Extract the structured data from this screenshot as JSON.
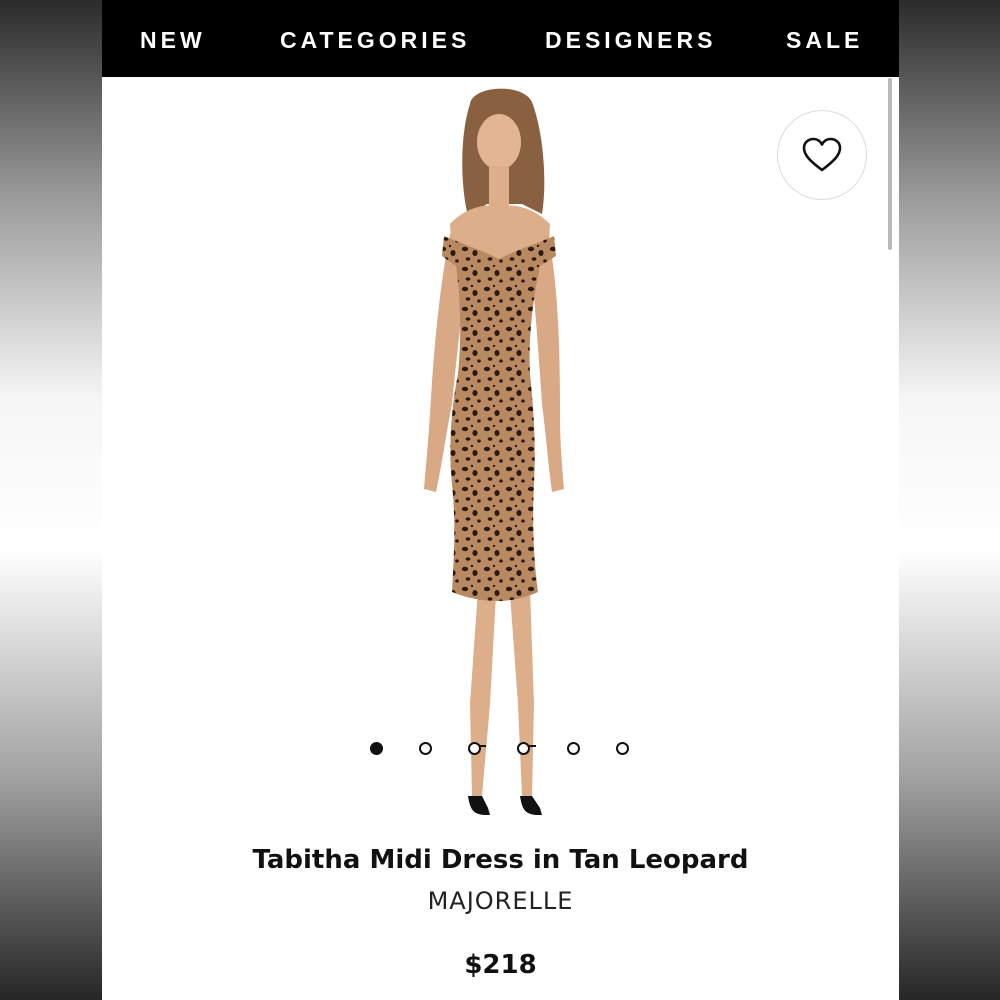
{
  "nav": {
    "items": [
      "NEW",
      "CATEGORIES",
      "DESIGNERS",
      "SALE"
    ]
  },
  "wishlist": {
    "icon": "heart-icon"
  },
  "carousel": {
    "total": 6,
    "active_index": 0
  },
  "product": {
    "title": "Tabitha Midi Dress in Tan Leopard",
    "brand": "MAJORELLE",
    "price": "$218"
  },
  "colors": {
    "nav_background": "#000000",
    "nav_text": "#ffffff",
    "dress_tan": "#b98a62",
    "spots": "#2a1a10"
  }
}
